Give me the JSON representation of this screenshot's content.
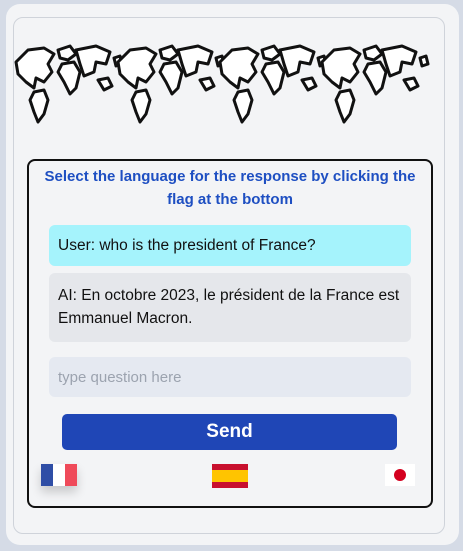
{
  "banner": {
    "icon": "world-map-icon"
  },
  "chat": {
    "instruction": "Select the language for the response by clicking the flag at the bottom",
    "messages": [
      {
        "role": "user",
        "text": "User: who is the president of France?"
      },
      {
        "role": "ai",
        "text": "AI: En octobre 2023, le président de la France est Emmanuel Macron."
      }
    ],
    "input": {
      "placeholder": "type question here",
      "value": ""
    },
    "send_label": "Send"
  },
  "flags": [
    {
      "name": "france",
      "icon": "france-flag-icon",
      "colors": [
        "#2f4ea6",
        "#ffffff",
        "#ef4a5a"
      ]
    },
    {
      "name": "spain",
      "icon": "spain-flag-icon",
      "colors": [
        "#c8102e",
        "#ffc400",
        "#c8102e"
      ]
    },
    {
      "name": "japan",
      "icon": "japan-flag-icon",
      "colors": [
        "#ffffff",
        "#d4001f"
      ]
    }
  ],
  "colors": {
    "accent": "#1e4fc2",
    "send_button": "#1f46b6",
    "user_bubble": "#a5f3fc",
    "ai_bubble": "#e5e7eb"
  }
}
